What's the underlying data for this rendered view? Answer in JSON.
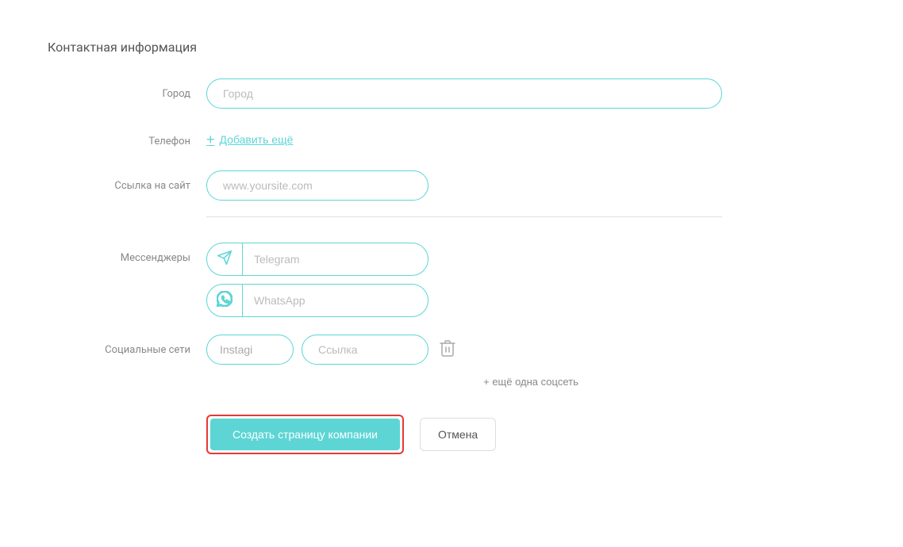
{
  "section": {
    "title": "Контактная информация"
  },
  "fields": {
    "city": {
      "label": "Город",
      "placeholder": "Город"
    },
    "phone": {
      "label": "Телефон",
      "add_more_label": "Добавить ещё"
    },
    "website": {
      "label": "Ссылка на сайт",
      "placeholder": "www.yoursite.com"
    },
    "messengers": {
      "label": "Мессенджеры",
      "telegram_placeholder": "Telegram",
      "whatsapp_placeholder": "WhatsApp"
    },
    "social": {
      "label": "Социальные сети",
      "select_value": "Instagi",
      "link_placeholder": "Ссылка",
      "add_label": "+ ещё одна соцсеть"
    }
  },
  "actions": {
    "create_label": "Создать страницу компании",
    "cancel_label": "Отмена"
  },
  "icons": {
    "telegram": "telegram-icon",
    "whatsapp": "whatsapp-icon",
    "trash": "trash-icon",
    "plus": "plus-icon"
  }
}
